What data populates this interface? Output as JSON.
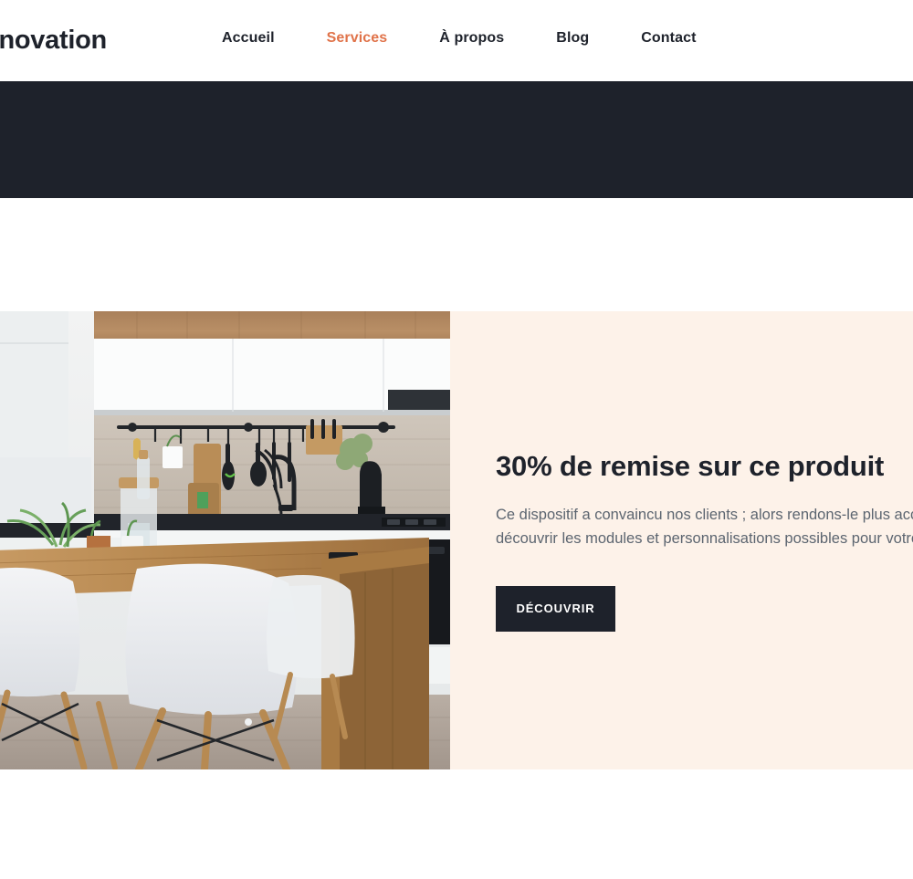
{
  "header": {
    "brand": "Rénovation",
    "nav": [
      {
        "label": "Accueil",
        "active": false
      },
      {
        "label": "Services",
        "active": true
      },
      {
        "label": "À propos",
        "active": false
      },
      {
        "label": "Blog",
        "active": false
      },
      {
        "label": "Contact",
        "active": false
      }
    ]
  },
  "hero": {
    "background_color": "#1e222b"
  },
  "promo": {
    "title": "30% de remise sur ce produit",
    "text": "Ce dispositif a convaincu nos clients ; alors rendons-le plus accessible ! Venez découvrir les modules et personnalisations possibles pour votre projet.",
    "cta_label": "DÉCOUVRIR",
    "background_color": "#fdf2e9",
    "image_alt": "Cuisine moderne avec table en bois et chaises blanches"
  },
  "colors": {
    "accent": "#e0734a",
    "dark": "#1e222b",
    "cream": "#fdf2e9",
    "body_text": "#5c6570"
  }
}
